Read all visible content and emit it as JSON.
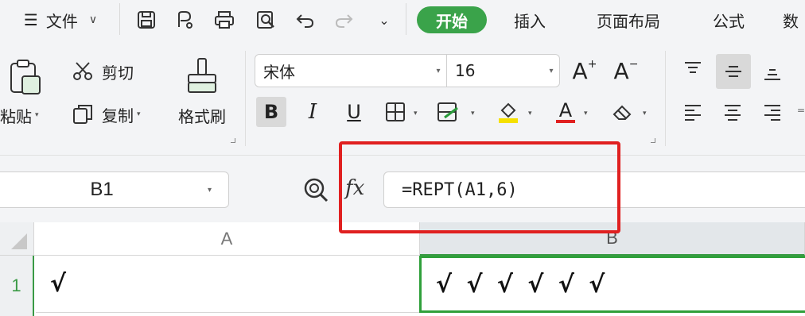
{
  "menubar": {
    "file_label": "文件",
    "tabs": [
      {
        "label": "开始",
        "active": true
      },
      {
        "label": "插入",
        "active": false
      },
      {
        "label": "页面布局",
        "active": false
      },
      {
        "label": "公式",
        "active": false
      },
      {
        "label": "数",
        "active": false
      }
    ]
  },
  "ribbon": {
    "paste_label": "粘贴",
    "cut_label": "剪切",
    "copy_label": "复制",
    "format_painter_label": "格式刷",
    "font_name": "宋体",
    "font_size": "16",
    "increase_font_label": "A",
    "decrease_font_label": "A",
    "bold_label": "B",
    "italic_label": "I",
    "underline_label": "U",
    "font_color_label": "A"
  },
  "formula_bar": {
    "name_box": "B1",
    "fx_label": "fx",
    "formula": "=REPT(A1,6)"
  },
  "sheet": {
    "columns": [
      "A",
      "B"
    ],
    "rows": [
      "1"
    ],
    "cells": {
      "A1": "√",
      "B1": "√ √ √ √ √ √"
    }
  },
  "colors": {
    "accent": "#3aa34a",
    "highlight": "#e02020",
    "font_color_bar": "#e02020",
    "fill_color_bar": "#f5e000"
  }
}
